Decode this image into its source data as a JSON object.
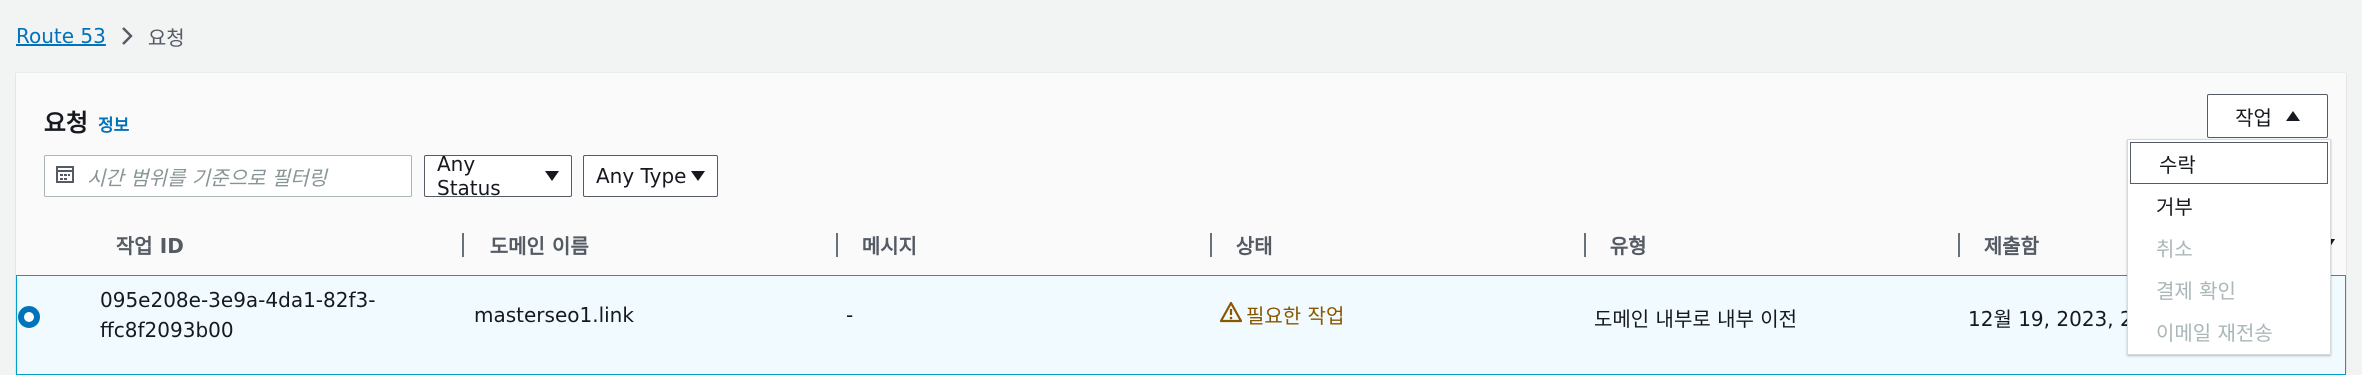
{
  "breadcrumb": {
    "root": "Route 53",
    "current": "요청"
  },
  "panel": {
    "title": "요청",
    "info": "정보"
  },
  "filters": {
    "search_placeholder": "시간 범위를 기준으로 필터링",
    "status_select": "Any Status",
    "type_select": "Any Type"
  },
  "action_button": {
    "label": "작업"
  },
  "columns": [
    "작업 ID",
    "도메인 이름",
    "메시지",
    "상태",
    "유형",
    "제출함"
  ],
  "rows": [
    {
      "job_id_line1": "095e208e-3e9a-4da1-82f3-",
      "job_id_line2": "ffc8f2093b00",
      "domain": "masterseo1.link",
      "message": "-",
      "status": "필요한 작업",
      "type": "도메인 내부로 내부 이전",
      "submitted": "12월 19, 2023, 2"
    }
  ],
  "dropdown": {
    "items": [
      {
        "label": "수락",
        "enabled": true
      },
      {
        "label": "거부",
        "enabled": true
      },
      {
        "label": "취소",
        "enabled": false
      },
      {
        "label": "결제 확인",
        "enabled": false
      },
      {
        "label": "이메일 재전송",
        "enabled": false
      }
    ]
  },
  "colors": {
    "link": "#0073bb",
    "warning": "#8a5700",
    "selected_row": "#f1faff",
    "selected_border": "#00a1c9"
  },
  "icons": [
    "chevron-right-icon",
    "calendar-icon",
    "caret-down-icon",
    "caret-up-icon",
    "warning-icon",
    "radio-selected-icon",
    "sort-desc-icon"
  ]
}
